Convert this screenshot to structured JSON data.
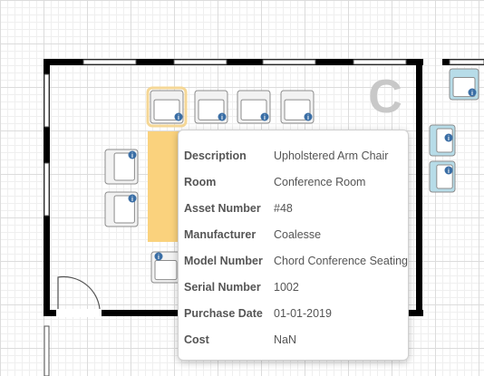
{
  "room_letter": "C",
  "colors": {
    "wall": "#000000",
    "highlight": "#fad27d",
    "selection_glow": "#f5d796",
    "chair_fill": "#f2f2f2",
    "chair_stroke": "#8c8c8c",
    "chair_alt_fill": "#b7dce8",
    "info_badge": "#3a6ea5"
  },
  "tooltip": {
    "rows": [
      {
        "label": "Description",
        "value": "Upholstered Arm Chair"
      },
      {
        "label": "Room",
        "value": "Conference Room"
      },
      {
        "label": "Asset Number",
        "value": "#48"
      },
      {
        "label": "Manufacturer",
        "value": "Coalesse"
      },
      {
        "label": "Model Number",
        "value": "Chord Conference Seating"
      },
      {
        "label": "Serial Number",
        "value": "1002"
      },
      {
        "label": "Purchase Date",
        "value": "01-01-2019"
      },
      {
        "label": "Cost",
        "value": "NaN"
      }
    ]
  }
}
